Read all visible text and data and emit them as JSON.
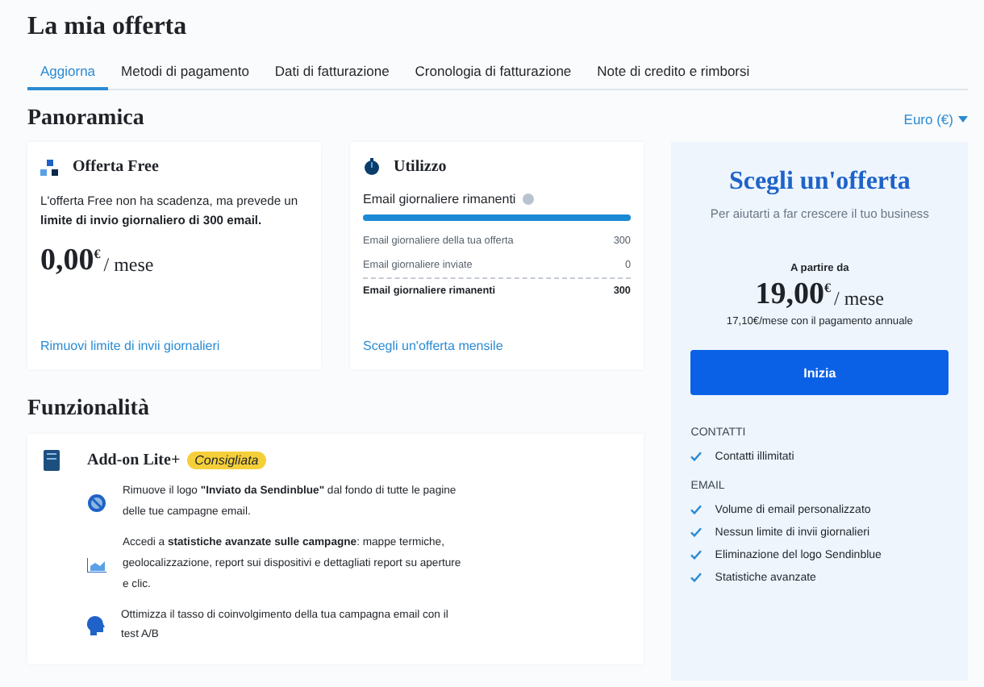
{
  "title": "La mia offerta",
  "tabs": [
    {
      "label": "Aggiorna",
      "selected": true
    },
    {
      "label": "Metodi di pagamento",
      "selected": false
    },
    {
      "label": "Dati di fatturazione",
      "selected": false
    },
    {
      "label": "Cronologia di fatturazione",
      "selected": false
    },
    {
      "label": "Note di credito e rimborsi",
      "selected": false
    }
  ],
  "overview": {
    "heading": "Panoramica",
    "currency_select": "Euro (€)"
  },
  "free_card": {
    "title": "Offerta Free",
    "description": "L'offerta Free non ha scadenza, ma prevede un **limite di invio giornaliero di 300 email.**",
    "amount": "0,00",
    "currency": "€",
    "period": "/ mese",
    "link": "Rimuovi limite di invii giornalieri"
  },
  "usage_card": {
    "title": "Utilizzo",
    "meter_label": "Email giornaliere rimanenti",
    "level": 1,
    "rows": [
      {
        "label": "Email giornaliere della tua offerta",
        "value": "300",
        "total": false
      },
      {
        "label": "Email giornaliere inviate",
        "value": "0",
        "total": false
      },
      {
        "label": "Email giornaliere rimanenti",
        "value": "300",
        "total": true
      }
    ],
    "link": "Scegli un'offerta mensile"
  },
  "features": {
    "heading": "Funzionalità",
    "addon_title": "Add-on Lite+",
    "badge": "Consigliata",
    "items": [
      {
        "kind": "logo",
        "text": "Rimuove il logo **\"Inviato da Sendinblue\"** dal fondo di tutte le pagine delle tue campagne email."
      },
      {
        "kind": "stats",
        "text": "Accedi a **statistiche avanzate sulle campagne**: mappe termiche, geolocalizzazione, report sui dispositivi e dettagliati report su aperture e clic."
      },
      {
        "kind": "ab",
        "text": "Ottimizza il tasso di coinvolgimento della tua campagna email con il test A/B"
      }
    ]
  },
  "offer_panel": {
    "title": "Scegli un'offerta",
    "subtitle": "Per aiutarti a far crescere il tuo business",
    "from": "A partire da",
    "amount": "19,00",
    "currency": "€",
    "period": "/ mese",
    "annual_note": "17,10€/mese con il pagamento annuale",
    "button": "Inizia",
    "groups": [
      {
        "heading": "CONTATTI",
        "items": [
          "Contatti illimitati"
        ]
      },
      {
        "heading": "EMAIL",
        "items": [
          "Volume di email personalizzato",
          "Nessun limite di invii giornalieri",
          "Eliminazione del logo Sendinblue",
          "Statistiche avanzate"
        ]
      }
    ]
  }
}
